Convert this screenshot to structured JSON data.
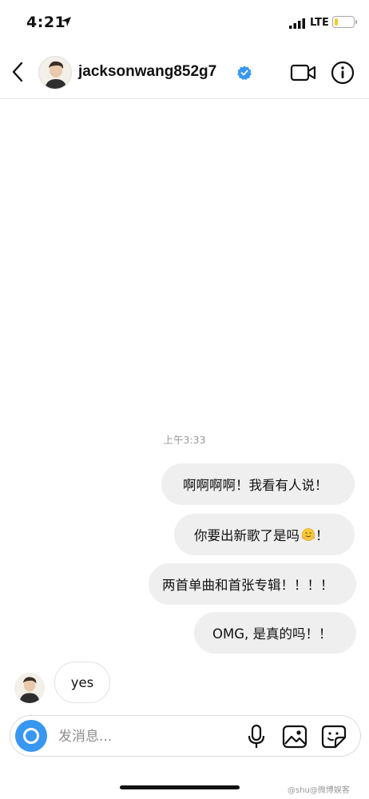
{
  "status_bar": {
    "time": "4:21",
    "network": "LTE",
    "battery_level": 0.2,
    "battery_color": "#f1cc24"
  },
  "header": {
    "username": "jacksonwang852g7",
    "verified": true,
    "icons": [
      "chevron-left-icon",
      "video-call-icon",
      "info-icon"
    ],
    "verified_color": "#3897f0"
  },
  "conversation": {
    "timestamp": "上午3:33",
    "messages": [
      {
        "from": "me",
        "text": "啊啊啊啊！我看有人说！"
      },
      {
        "from": "me",
        "text": "你要出新歌了是吗"
      },
      {
        "from": "me",
        "text": "两首单曲和首张专辑！！！！"
      },
      {
        "from": "me",
        "text": "OMG, 是真的吗！！"
      },
      {
        "from": "them",
        "text": "yes"
      }
    ],
    "emoji_in_message_2": "hugging-face-emoji",
    "exclamation_after_emoji": "！"
  },
  "composer": {
    "placeholder": "发消息...",
    "camera_color": "#3897f0",
    "icons": [
      "camera-icon",
      "microphone-icon",
      "gallery-icon",
      "sticker-icon"
    ]
  },
  "watermark": {
    "text": "@shu@微博娱客"
  }
}
